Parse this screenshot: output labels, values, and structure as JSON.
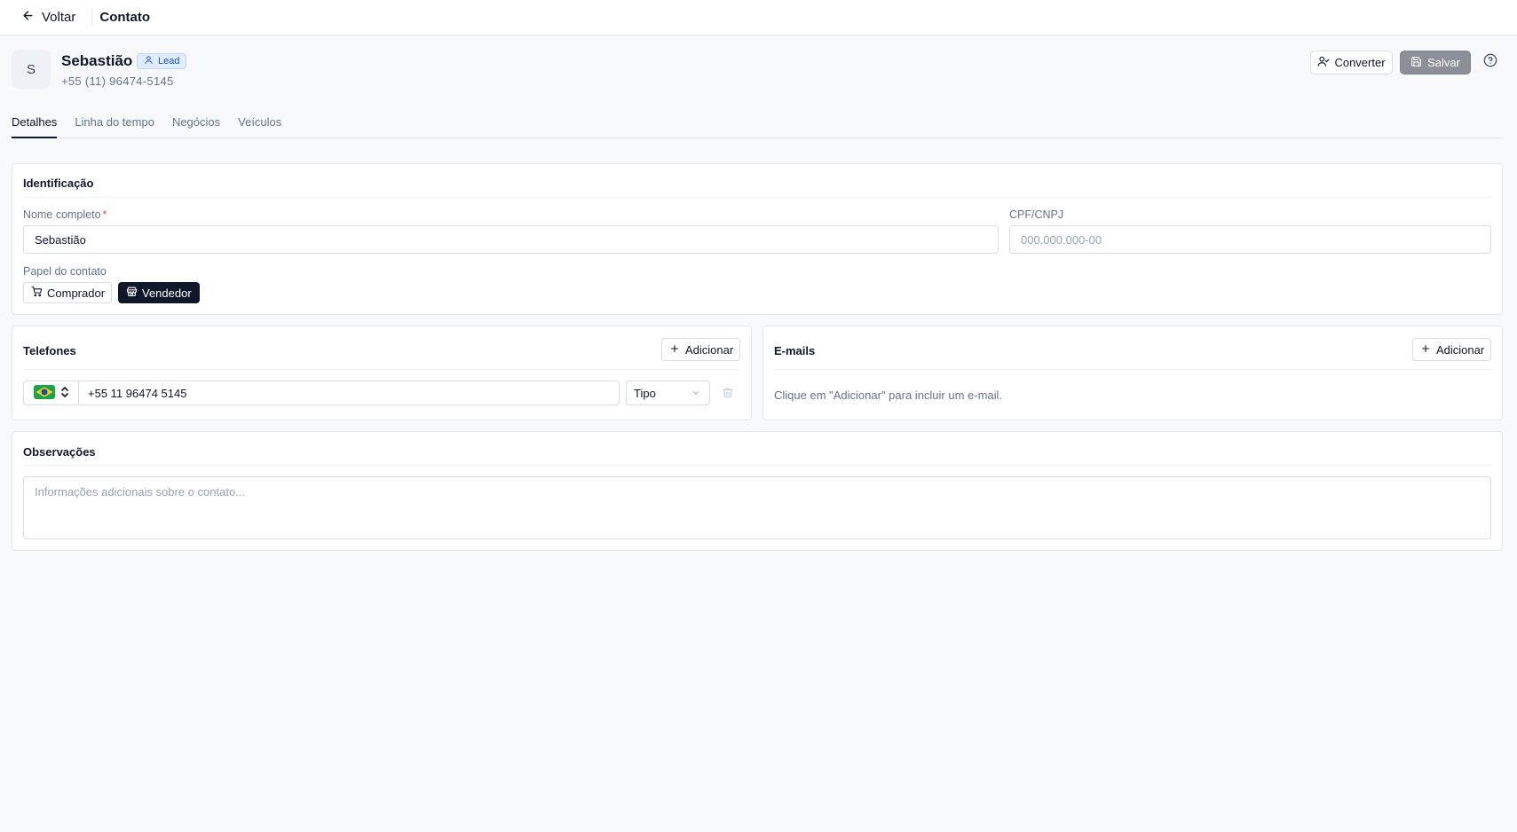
{
  "topbar": {
    "back_label": "Voltar",
    "title": "Contato"
  },
  "contact": {
    "initial": "S",
    "name": "Sebastião",
    "badge": "Lead",
    "phone": "+55 (11) 96474-5145"
  },
  "actions": {
    "convert_label": "Converter",
    "save_label": "Salvar"
  },
  "tabs": [
    {
      "label": "Detalhes",
      "active": true
    },
    {
      "label": "Linha do tempo",
      "active": false
    },
    {
      "label": "Negócios",
      "active": false
    },
    {
      "label": "Veículos",
      "active": false
    }
  ],
  "identification": {
    "title": "Identificação",
    "full_name_label": "Nome completo",
    "required_mark": "*",
    "full_name_value": "Sebastião",
    "doc_label": "CPF/CNPJ",
    "doc_placeholder": "000.000.000-00",
    "role_label": "Papel do contato",
    "roles": [
      {
        "label": "Comprador",
        "selected": false,
        "icon": "cart-icon"
      },
      {
        "label": "Vendedor",
        "selected": true,
        "icon": "store-icon"
      }
    ]
  },
  "phones": {
    "title": "Telefones",
    "add_label": "Adicionar",
    "items": [
      {
        "country_flag": "brazil-flag-icon",
        "number": "+55 11 96474 5145",
        "type_placeholder": "Tipo"
      }
    ]
  },
  "emails": {
    "title": "E-mails",
    "add_label": "Adicionar",
    "empty_text": "Clique em \"Adicionar\" para incluir um e-mail."
  },
  "notes": {
    "title": "Observações",
    "placeholder": "Informações adicionais sobre o contato..."
  },
  "colors": {
    "primary": "#0f172a",
    "muted": "#64748b",
    "badge_bg": "#e0ecff",
    "save_disabled": "#8a8f98",
    "required": "#ef4444"
  }
}
